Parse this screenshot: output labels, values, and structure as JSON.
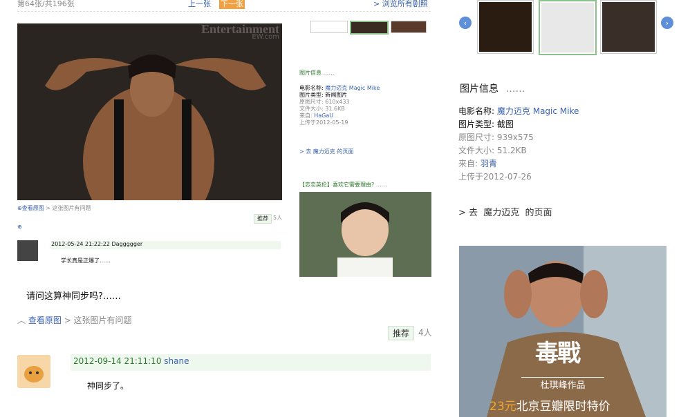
{
  "top": {
    "counter": "第64张/共196张",
    "prev": "上一张",
    "next": "下一张",
    "browse_all": "> 浏览所有剧照"
  },
  "small_info": {
    "title": "图片信息",
    "dots": "……",
    "movie_label": "电影名称:",
    "movie_cn": "魔力迈克",
    "movie_en": "Magic Mike",
    "type_label": "图片类型:",
    "type_value": "新闻图片",
    "size_label": "原图尺寸:",
    "size_value": "610x433",
    "filesize_label": "文件大小:",
    "filesize_value": "31.6KB",
    "from_label": "来自:",
    "from_value": "HaGaU",
    "uploaded": "上传于2012-05-19",
    "goto": "> 去 魔力迈克 的页面"
  },
  "ad_small": {
    "title": "【恋恋英伦】喜欢它需要理由?",
    "dots": "……"
  },
  "small_tools": {
    "view_original": "查看原图",
    "report": "> 这张图片有问题",
    "recommend": "推荐",
    "count": "5人"
  },
  "small_comment": {
    "meta": "2012-05-24 21:22:22 Daggggger",
    "text": "学长真是正爆了……"
  },
  "main": {
    "question": "请问这算神同步吗?……",
    "view_original": "查看原图",
    "report": "> 这张图片有问题",
    "recommend": "推荐",
    "count": "4人"
  },
  "comment": {
    "time": "2012-09-14 21:11:10",
    "user": "shane",
    "text": "神同步了。"
  },
  "info": {
    "title": "图片信息",
    "dots": "……",
    "movie_label": "电影名称:",
    "movie_cn": "魔力迈克",
    "movie_en": "Magic Mike",
    "type_label": "图片类型:",
    "type_value": "截图",
    "size_label": "原图尺寸:",
    "size_value": "939x575",
    "filesize_label": "文件大小:",
    "filesize_value": "51.2KB",
    "from_label": "来自:",
    "from_value": "羽青",
    "uploaded": "上传于2012-07-26",
    "goto": "> 去  魔力迈克  的页面"
  },
  "photo_watermark": "Entertainment",
  "photo_watermark2": "EW.com",
  "ad_big": {
    "logo": "毒戰",
    "subtitle": "杜琪峰作品",
    "price": "23元",
    "promo": "北京豆瓣限时特价"
  },
  "colors": {
    "link": "#3a62b0",
    "green": "#2a7a2a",
    "accent_bar": "#eef8ee"
  }
}
